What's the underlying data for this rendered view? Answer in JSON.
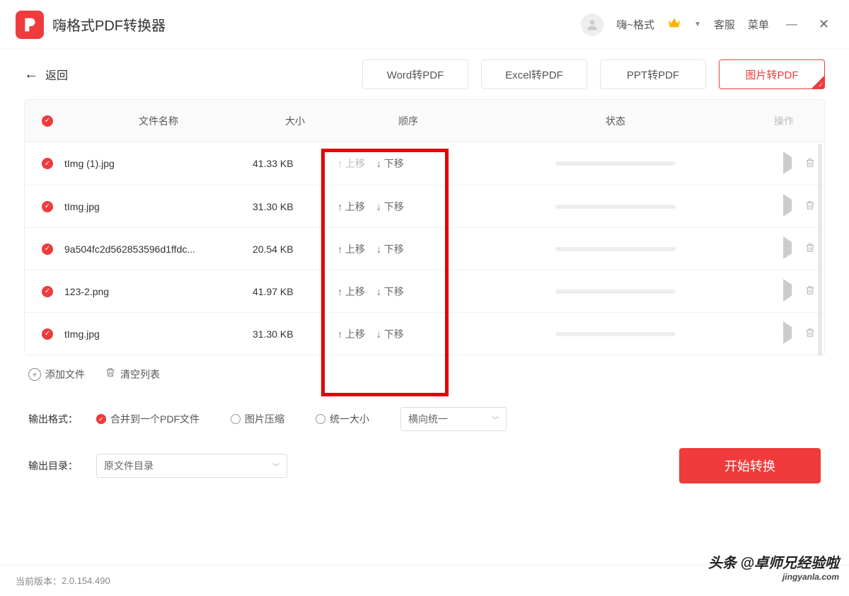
{
  "app": {
    "title": "嗨格式PDF转换器",
    "user_name": "嗨~格式",
    "help": "客服",
    "menu": "菜单"
  },
  "toolbar": {
    "back": "返回",
    "tabs": [
      {
        "label": "Word转PDF",
        "active": false
      },
      {
        "label": "Excel转PDF",
        "active": false
      },
      {
        "label": "PPT转PDF",
        "active": false
      },
      {
        "label": "图片转PDF",
        "active": true
      }
    ]
  },
  "table": {
    "headers": {
      "name": "文件名称",
      "size": "大小",
      "order": "顺序",
      "status": "状态",
      "ops": "操作"
    },
    "move_up": "上移",
    "move_down": "下移",
    "rows": [
      {
        "name": "tImg (1).jpg",
        "size": "41.33 KB",
        "up_disabled": true
      },
      {
        "name": "tImg.jpg",
        "size": "31.30 KB",
        "up_disabled": false
      },
      {
        "name": "9a504fc2d562853596d1ffdc...",
        "size": "20.54 KB",
        "up_disabled": false
      },
      {
        "name": "123-2.png",
        "size": "41.97 KB",
        "up_disabled": false
      },
      {
        "name": "tImg.jpg",
        "size": "31.30 KB",
        "up_disabled": false
      }
    ]
  },
  "below": {
    "add_file": "添加文件",
    "clear_list": "清空列表"
  },
  "options": {
    "format_label": "输出格式：",
    "merge_one": "合并到一个PDF文件",
    "compress": "图片压缩",
    "unify_size": "统一大小",
    "orientation": "横向统一"
  },
  "outdir": {
    "label": "输出目录：",
    "value": "原文件目录"
  },
  "convert": "开始转换",
  "footer": {
    "version_label": "当前版本：",
    "version": "2.0.154.490"
  },
  "watermark": {
    "line1": "头条 @卓师兄经验啦",
    "line2": "jingyanla.com"
  }
}
